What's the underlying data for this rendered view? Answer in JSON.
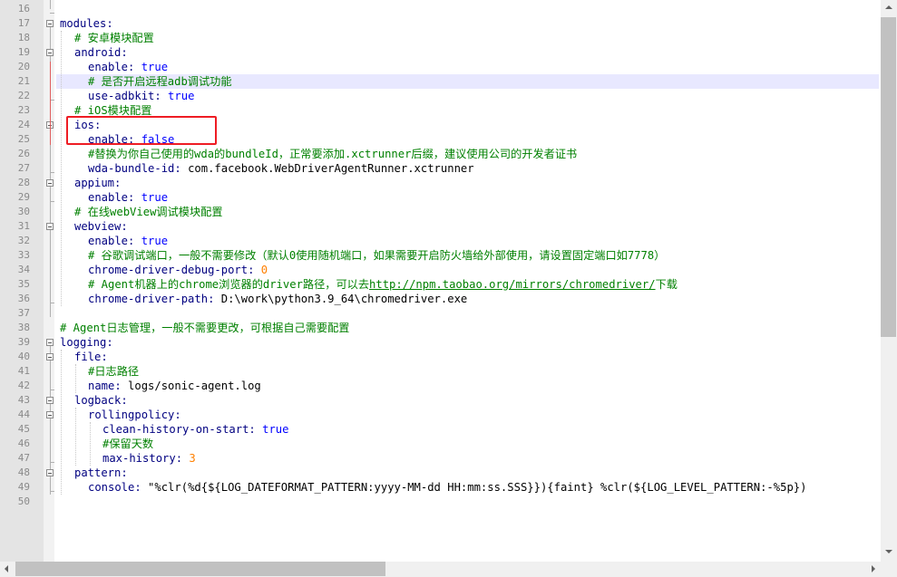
{
  "editor": {
    "line_numbers": [
      "16",
      "17",
      "18",
      "19",
      "20",
      "21",
      "22",
      "23",
      "24",
      "25",
      "26",
      "27",
      "28",
      "29",
      "30",
      "31",
      "32",
      "33",
      "34",
      "35",
      "36",
      "37",
      "38",
      "39",
      "40",
      "41",
      "42",
      "43",
      "44",
      "45",
      "46",
      "47",
      "48",
      "49",
      "50"
    ],
    "lines": {
      "l17": {
        "key": "modules:"
      },
      "l18": {
        "comment": "# 安卓模块配置"
      },
      "l19": {
        "key": "android:"
      },
      "l20": {
        "key": "enable:",
        "value": " true"
      },
      "l21": {
        "comment": "# 是否开启远程adb调试功能"
      },
      "l22": {
        "key": "use-adbkit:",
        "value": " true"
      },
      "l23": {
        "comment": "# iOS模块配置"
      },
      "l24": {
        "key": "ios:"
      },
      "l25": {
        "key": "enable:",
        "value": " false"
      },
      "l26": {
        "comment": "#替换为你自己使用的wda的bundleId，正常要添加.xctrunner后缀，建议使用公司的开发者证书"
      },
      "l27": {
        "key": "wda-bundle-id:",
        "value": " com.facebook.WebDriverAgentRunner.xctrunner"
      },
      "l28": {
        "key": "appium:"
      },
      "l29": {
        "key": "enable:",
        "value": " true"
      },
      "l30": {
        "comment": "# 在线webView调试模块配置"
      },
      "l31": {
        "key": "webview:"
      },
      "l32": {
        "key": "enable:",
        "value": " true"
      },
      "l33": {
        "comment": "# 谷歌调试端口，一般不需要修改（默认0使用随机端口，如果需要开启防火墙给外部使用，请设置固定端口如7778）"
      },
      "l34": {
        "key": "chrome-driver-debug-port:",
        "value": " 0"
      },
      "l35": {
        "comment": "# Agent机器上的chrome浏览器的driver路径，可以去",
        "link": "http://npm.taobao.org/mirrors/chromedriver/",
        "tail": "下载"
      },
      "l36": {
        "key": "chrome-driver-path:",
        "value": " D:\\work\\python3.9_64\\chromedriver.exe"
      },
      "l38": {
        "comment": "# Agent日志管理，一般不需要更改，可根据自己需要配置"
      },
      "l39": {
        "key": "logging:"
      },
      "l40": {
        "key": "file:"
      },
      "l41": {
        "comment": "#日志路径"
      },
      "l42": {
        "key": "name:",
        "value": " logs/sonic-agent.log"
      },
      "l43": {
        "key": "logback:"
      },
      "l44": {
        "key": "rollingpolicy:"
      },
      "l45": {
        "key": "clean-history-on-start:",
        "value": " true"
      },
      "l46": {
        "comment": "#保留天数"
      },
      "l47": {
        "key": "max-history:",
        "value": " 3"
      },
      "l48": {
        "key": "pattern:"
      },
      "l49": {
        "key": "console:",
        "value": " \"%clr(%d{${LOG_DATEFORMAT_PATTERN:yyyy-MM-dd HH:mm:ss.SSS}}){faint} %clr(${LOG_LEVEL_PATTERN:-%5p})"
      }
    }
  },
  "colors": {
    "key": "#000080",
    "bool": "#0000ff",
    "comment": "#008000",
    "number": "#ff8000",
    "current_line": "#e8e8ff",
    "annotation": "#ee1c24"
  }
}
